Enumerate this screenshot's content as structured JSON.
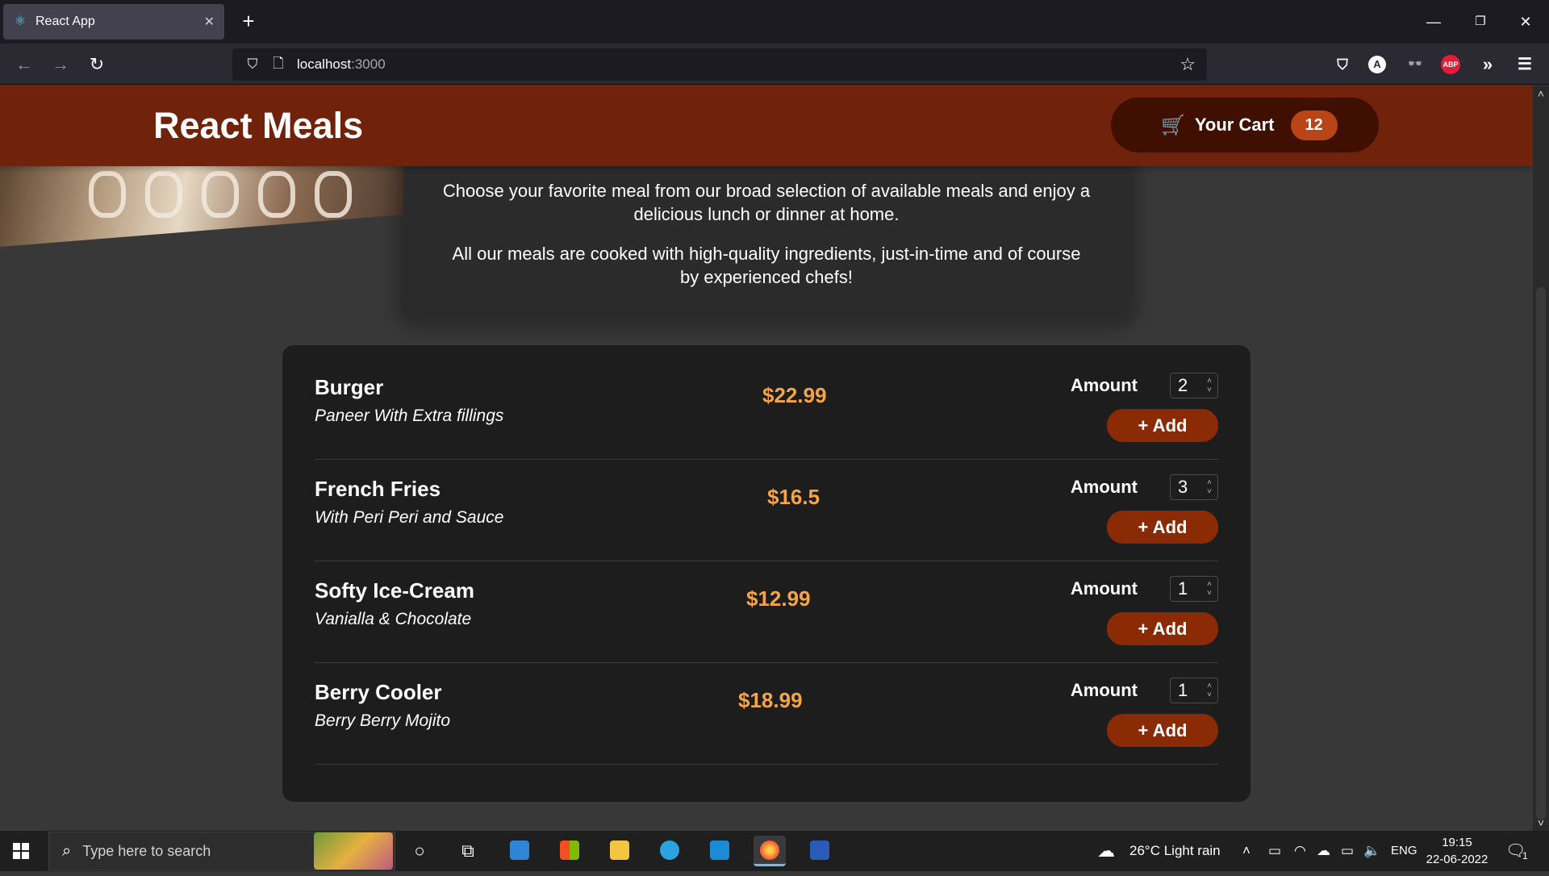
{
  "browser": {
    "tab_title": "React App",
    "url_host": "localhost",
    "url_port": ":3000",
    "extensions": {
      "account": "A",
      "adblock": "ABP"
    }
  },
  "app": {
    "title": "React Meals",
    "cart_label": "Your Cart",
    "cart_count": "12",
    "summary": [
      "Choose your favorite meal from our broad selection of available meals and enjoy a delicious lunch or dinner at home.",
      "All our meals are cooked with high-quality ingredients, just-in-time and of course by experienced chefs!"
    ],
    "amount_label": "Amount",
    "add_label": "+ Add",
    "meals": [
      {
        "name": "Burger",
        "description": "Paneer With Extra fillings",
        "price": "$22.99",
        "amount": "2"
      },
      {
        "name": "French Fries",
        "description": "With Peri Peri and Sauce",
        "price": "$16.5",
        "amount": "3"
      },
      {
        "name": "Softy Ice-Cream",
        "description": "Vanialla & Chocolate",
        "price": "$12.99",
        "amount": "1"
      },
      {
        "name": "Berry Cooler",
        "description": "Berry Berry Mojito",
        "price": "$18.99",
        "amount": "1"
      }
    ]
  },
  "taskbar": {
    "search_placeholder": "Type here to search",
    "weather": "26°C  Light rain",
    "language": "ENG",
    "time": "19:15",
    "date": "22-06-2022",
    "notifications": "1"
  },
  "colors": {
    "header": "#70220a",
    "cart_button": "#3f0f02",
    "badge": "#b94517",
    "price": "#f5a547",
    "add_button": "#8a2b06"
  }
}
